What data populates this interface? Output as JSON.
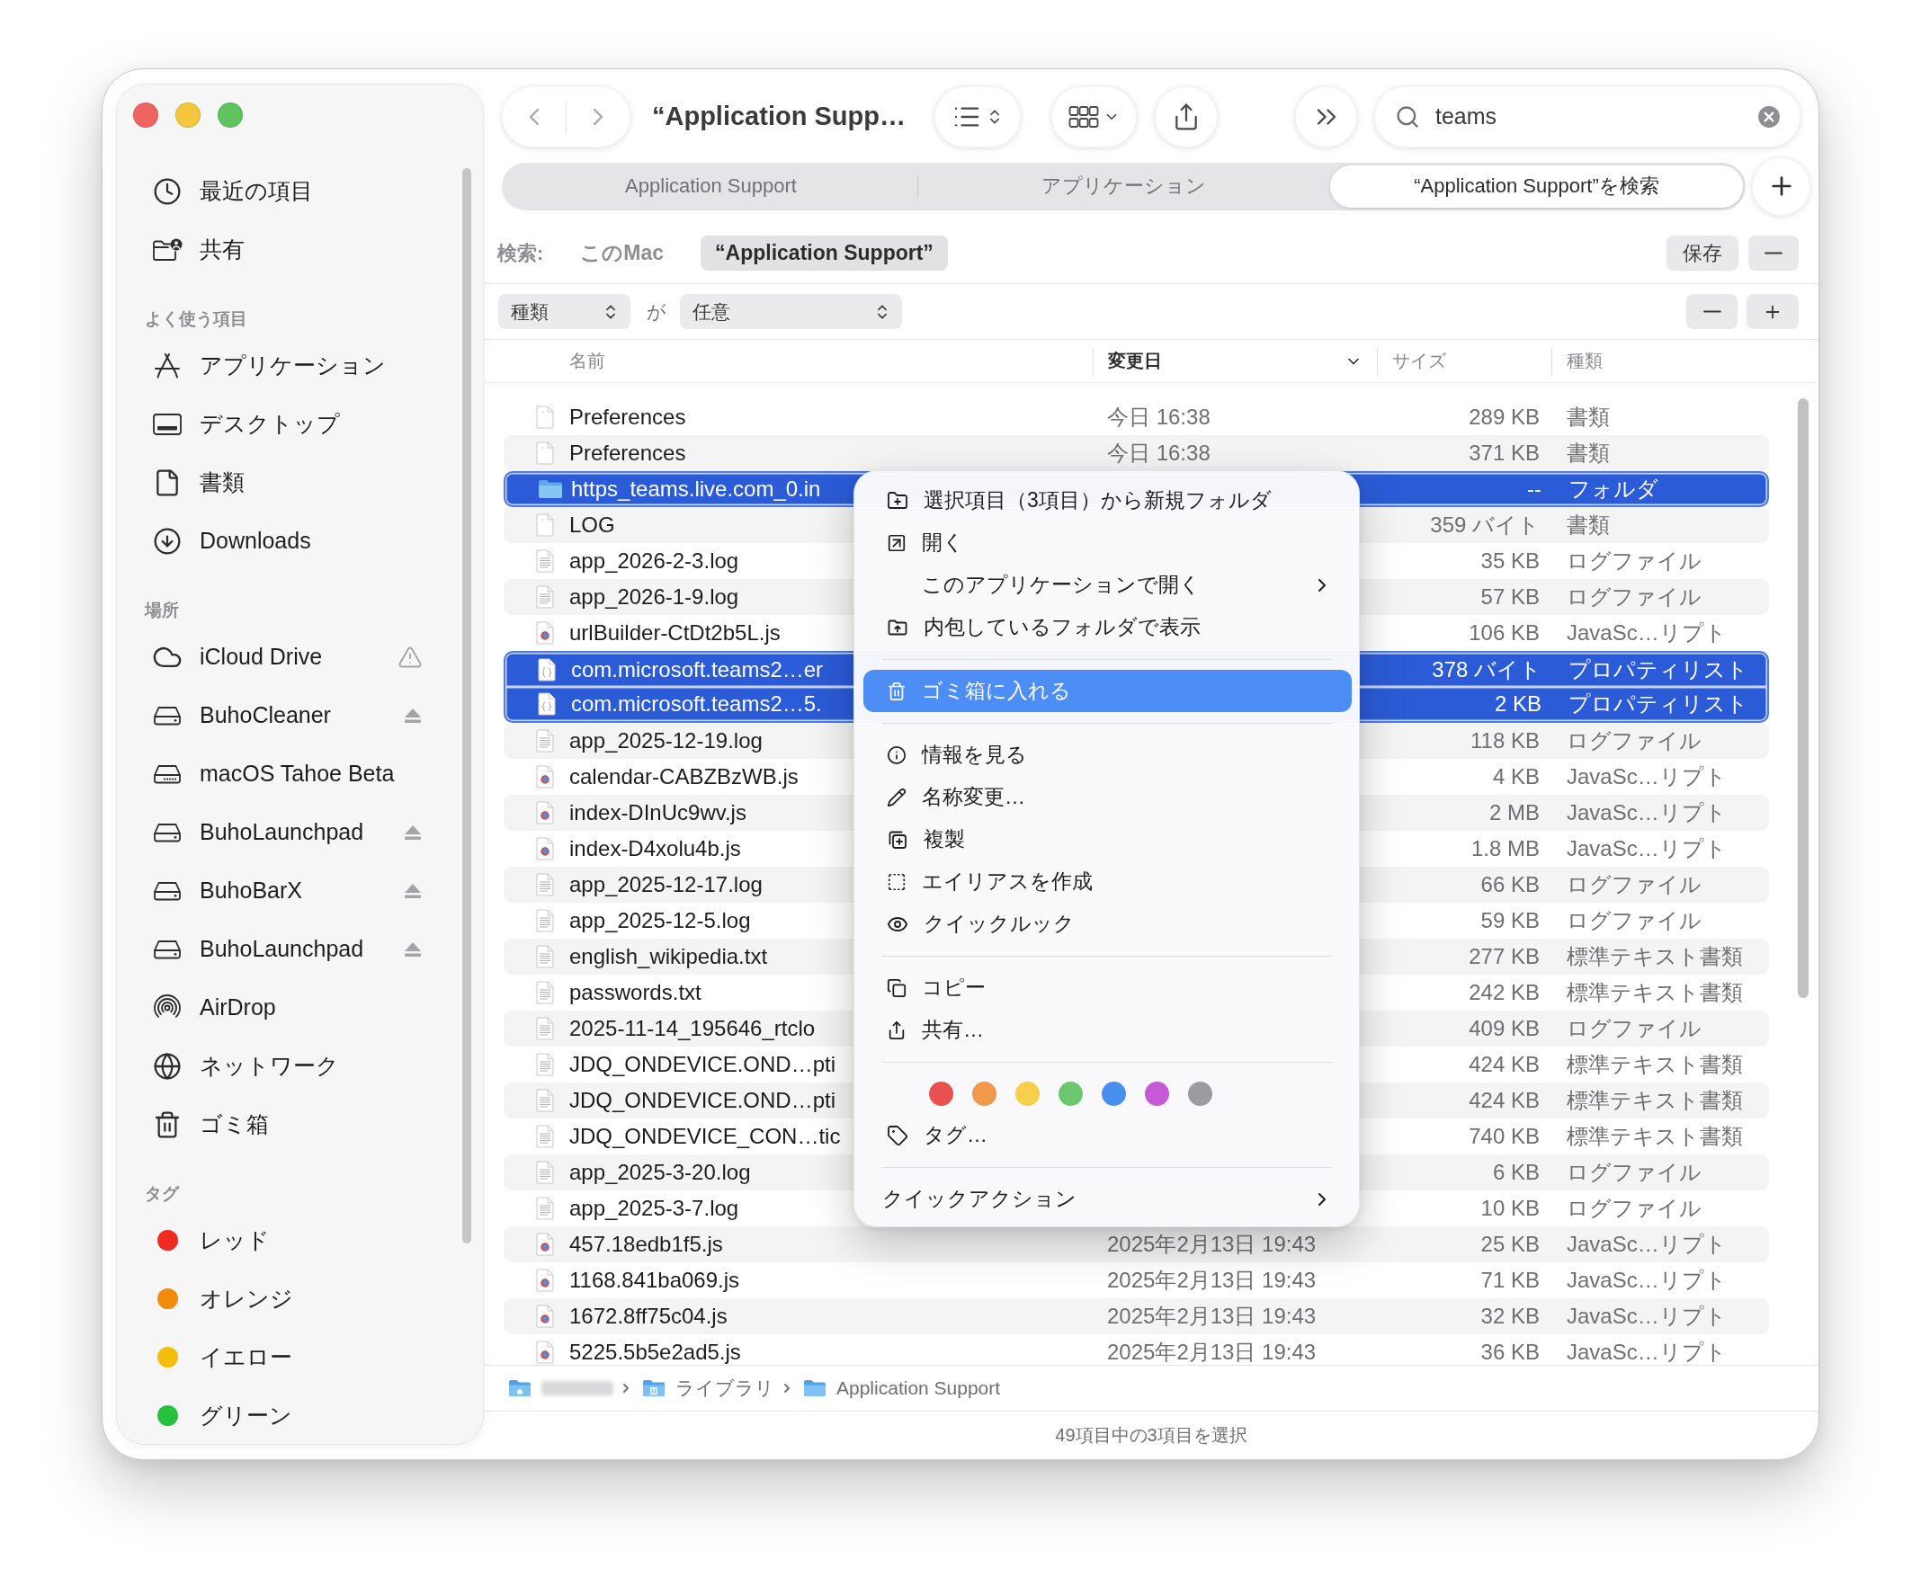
{
  "window": {
    "title": "“Application Supp…"
  },
  "toolbar": {
    "search": {
      "value": "teams"
    }
  },
  "tabs": [
    {
      "label": "Application Support",
      "selected": false
    },
    {
      "label": "アプリケーション",
      "selected": false
    },
    {
      "label": "“Application Support”を検索",
      "selected": true
    }
  ],
  "search_scope": {
    "label": "検索:",
    "options": [
      {
        "label": "このMac",
        "selected": false
      },
      {
        "label": "“Application Support”",
        "selected": true
      }
    ],
    "save": "保存"
  },
  "criteria": {
    "attribute": "種類",
    "connector": "が",
    "value": "任意"
  },
  "sidebar": {
    "sections": [
      {
        "items": [
          {
            "kind": "recent",
            "label": "最近の項目",
            "selected": false
          },
          {
            "kind": "shared",
            "label": "共有",
            "selected": false
          }
        ]
      },
      {
        "header": "よく使う項目",
        "items": [
          {
            "kind": "apps",
            "label": "アプリケーション",
            "selected": false
          },
          {
            "kind": "desktop",
            "label": "デスクトップ",
            "selected": false
          },
          {
            "kind": "documents",
            "label": "書類",
            "selected": false
          },
          {
            "kind": "downloads",
            "label": "Downloads",
            "selected": false
          }
        ]
      },
      {
        "header": "場所",
        "items": [
          {
            "kind": "cloud",
            "label": "iCloud Drive",
            "alert": true,
            "ejectable": false,
            "selected": false
          },
          {
            "kind": "drive",
            "label": "BuhoCleaner",
            "alert": false,
            "ejectable": true,
            "selected": false
          },
          {
            "kind": "internal",
            "label": "macOS Tahoe Beta",
            "alert": false,
            "ejectable": false,
            "selected": false
          },
          {
            "kind": "drive",
            "label": "BuhoLaunchpad",
            "alert": false,
            "ejectable": true,
            "selected": false
          },
          {
            "kind": "drive",
            "label": "BuhoBarX",
            "alert": false,
            "ejectable": true,
            "selected": false
          },
          {
            "kind": "drive",
            "label": "BuhoLaunchpad",
            "alert": false,
            "ejectable": true,
            "selected": false
          },
          {
            "kind": "airdrop",
            "label": "AirDrop",
            "alert": false,
            "ejectable": false,
            "selected": false
          },
          {
            "kind": "network",
            "label": "ネットワーク",
            "alert": false,
            "ejectable": false,
            "selected": false
          },
          {
            "kind": "trash",
            "label": "ゴミ箱",
            "alert": false,
            "ejectable": false,
            "selected": false
          }
        ]
      },
      {
        "header": "タグ",
        "items": [
          {
            "kind": "tag",
            "label": "レッド",
            "color": "#f02b22",
            "selected": false
          },
          {
            "kind": "tag",
            "label": "オレンジ",
            "color": "#f28a0a",
            "selected": false
          },
          {
            "kind": "tag",
            "label": "イエロー",
            "color": "#f5be0a",
            "selected": false
          },
          {
            "kind": "tag",
            "label": "グリーン",
            "color": "#27c03f",
            "selected": false
          }
        ]
      }
    ]
  },
  "columns": [
    {
      "label": "名前",
      "sorted": false
    },
    {
      "label": "変更日",
      "sorted": true
    },
    {
      "label": "サイズ",
      "sorted": false
    },
    {
      "label": "種類",
      "sorted": false
    }
  ],
  "rows": [
    {
      "kind": "doc",
      "name": "Preferences",
      "modified": "今日 16:38",
      "size": "289 KB",
      "type": "書類",
      "selected": false
    },
    {
      "kind": "doc",
      "name": "Preferences",
      "modified": "今日 16:38",
      "size": "371 KB",
      "type": "書類",
      "selected": false
    },
    {
      "kind": "folder",
      "name": "https_teams.live.com_0.in",
      "size": "--",
      "type": "フォルダ",
      "selected": true
    },
    {
      "kind": "doc",
      "name": "LOG",
      "size": "359 バイト",
      "type": "書類",
      "selected": false
    },
    {
      "kind": "lines",
      "name": "app_2026-2-3.log",
      "size": "35 KB",
      "type": "ログファイル",
      "selected": false
    },
    {
      "kind": "lines",
      "name": "app_2026-1-9.log",
      "size": "57 KB",
      "type": "ログファイル",
      "selected": false
    },
    {
      "kind": "badge",
      "name": "urlBuilder-CtDt2b5L.js",
      "size": "106 KB",
      "type": "JavaSc…リプト",
      "selected": false
    },
    {
      "kind": "braces",
      "name": "com.microsoft.teams2…er",
      "size": "378 バイト",
      "type": "プロパティリスト",
      "selected": true
    },
    {
      "kind": "braces",
      "name": "com.microsoft.teams2…5.",
      "size": "2 KB",
      "type": "プロパティリスト",
      "selected": true
    },
    {
      "kind": "lines",
      "name": "app_2025-12-19.log",
      "size": "118 KB",
      "type": "ログファイル",
      "selected": false
    },
    {
      "kind": "badge",
      "name": "calendar-CABZBzWB.js",
      "size": "4 KB",
      "type": "JavaSc…リプト",
      "selected": false
    },
    {
      "kind": "badge",
      "name": "index-DInUc9wv.js",
      "size": "2 MB",
      "type": "JavaSc…リプト",
      "selected": false
    },
    {
      "kind": "badge",
      "name": "index-D4xolu4b.js",
      "size": "1.8 MB",
      "type": "JavaSc…リプト",
      "selected": false
    },
    {
      "kind": "lines",
      "name": "app_2025-12-17.log",
      "size": "66 KB",
      "type": "ログファイル",
      "selected": false
    },
    {
      "kind": "lines",
      "name": "app_2025-12-5.log",
      "size": "59 KB",
      "type": "ログファイル",
      "selected": false
    },
    {
      "kind": "lines",
      "name": "english_wikipedia.txt",
      "size": "277 KB",
      "type": "標準テキスト書類",
      "selected": false
    },
    {
      "kind": "lines",
      "name": "passwords.txt",
      "size": "242 KB",
      "type": "標準テキスト書類",
      "selected": false
    },
    {
      "kind": "lines",
      "name": "2025-11-14_195646_rtclo",
      "size": "409 KB",
      "type": "ログファイル",
      "selected": false
    },
    {
      "kind": "lines",
      "name": "JDQ_ONDEVICE.OND…pti",
      "size": "424 KB",
      "type": "標準テキスト書類",
      "selected": false
    },
    {
      "kind": "lines",
      "name": "JDQ_ONDEVICE.OND…pti",
      "size": "424 KB",
      "type": "標準テキスト書類",
      "selected": false
    },
    {
      "kind": "lines",
      "name": "JDQ_ONDEVICE_CON…tic",
      "size": "740 KB",
      "type": "標準テキスト書類",
      "selected": false
    },
    {
      "kind": "lines",
      "name": "app_2025-3-20.log",
      "size": "6 KB",
      "type": "ログファイル",
      "selected": false
    },
    {
      "kind": "lines",
      "name": "app_2025-3-7.log",
      "size": "10 KB",
      "type": "ログファイル",
      "selected": false
    },
    {
      "kind": "badge",
      "name": "457.18edb1f5.js",
      "modified": "2025年2月13日 19:43",
      "size": "25 KB",
      "type": "JavaSc…リプト",
      "selected": false
    },
    {
      "kind": "badge",
      "name": "1168.841ba069.js",
      "modified": "2025年2月13日 19:43",
      "size": "71 KB",
      "type": "JavaSc…リプト",
      "selected": false
    },
    {
      "kind": "badge",
      "name": "1672.8ff75c04.js",
      "modified": "2025年2月13日 19:43",
      "size": "32 KB",
      "type": "JavaSc…リプト",
      "selected": false
    },
    {
      "kind": "badge",
      "name": "5225.5b5e2ad5.js",
      "modified": "2025年2月13日 19:43",
      "size": "36 KB",
      "type": "JavaSc…リプト",
      "selected": false
    }
  ],
  "context_menu": {
    "sections": [
      {
        "items": [
          {
            "kind": "newfolder",
            "label": "選択項目（3項目）から新規フォルダ",
            "selected": false,
            "submenu": false
          },
          {
            "kind": "open",
            "label": "開く",
            "selected": false,
            "submenu": false
          },
          {
            "kind": "blank",
            "label": "このアプリケーションで開く",
            "selected": false,
            "submenu": true
          },
          {
            "kind": "reveal",
            "label": "内包しているフォルダで表示",
            "selected": false,
            "submenu": false
          }
        ]
      },
      {
        "items": [
          {
            "kind": "trash",
            "label": "ゴミ箱に入れる",
            "selected": true,
            "submenu": false
          }
        ]
      },
      {
        "items": [
          {
            "kind": "info",
            "label": "情報を見る",
            "selected": false,
            "submenu": false
          },
          {
            "kind": "rename",
            "label": "名称変更…",
            "selected": false,
            "submenu": false
          },
          {
            "kind": "duplicate",
            "label": "複製",
            "selected": false,
            "submenu": false
          },
          {
            "kind": "alias",
            "label": "エイリアスを作成",
            "selected": false,
            "submenu": false
          },
          {
            "kind": "quicklook",
            "label": "クイックルック",
            "selected": false,
            "submenu": false
          }
        ]
      },
      {
        "items": [
          {
            "kind": "copy",
            "label": "コピー",
            "selected": false,
            "submenu": false
          },
          {
            "kind": "share",
            "label": "共有…",
            "selected": false,
            "submenu": false
          }
        ]
      },
      {
        "tag_colors": [
          {
            "color": "#e9504f"
          },
          {
            "color": "#f0984b"
          },
          {
            "color": "#f6cf4b"
          },
          {
            "color": "#6cc870"
          },
          {
            "color": "#4a8ef0"
          },
          {
            "color": "#c45ad6"
          },
          {
            "color": "#9b9ba0"
          }
        ],
        "items": [
          {
            "kind": "tag",
            "label": "タグ…",
            "selected": false,
            "submenu": false
          }
        ]
      },
      {
        "items": [
          {
            "kind": "plain",
            "label": "クイックアクション",
            "selected": false,
            "submenu": true
          }
        ]
      }
    ]
  },
  "path_bar": [
    {
      "kind": "home"
    },
    {
      "kind": "library",
      "label": "ライブラリ"
    },
    {
      "kind": "folder",
      "label": "Application Support"
    }
  ],
  "status_bar": "49項目中の3項目を選択"
}
